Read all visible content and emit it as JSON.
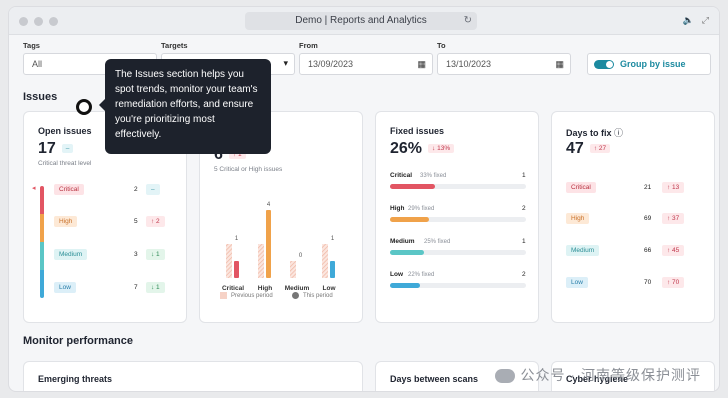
{
  "window": {
    "url_title": "Demo | Reports and Analytics",
    "reload_icon": "reload-icon"
  },
  "filters": {
    "tags_label": "Tags",
    "tags_value": "All",
    "targets_label": "Targets",
    "from_label": "From",
    "from_value": "13/09/2023",
    "to_label": "To",
    "to_value": "13/10/2023",
    "group_by_issue": "Group by issue"
  },
  "issues_heading": "Issues",
  "tooltip": {
    "text": "The Issues section helps you spot trends, monitor your team's remediation efforts, and ensure you're prioritizing most effectively."
  },
  "open_issues": {
    "title": "Open issues",
    "value": "17",
    "delta": "–",
    "sub": "Critical threat level",
    "rows": [
      {
        "label": "Critical",
        "count": "2",
        "delta": "–"
      },
      {
        "label": "High",
        "count": "5",
        "delta": "↑ 2"
      },
      {
        "label": "Medium",
        "count": "3",
        "delta": "↓ 1"
      },
      {
        "label": "Low",
        "count": "7",
        "delta": "↓ 1"
      }
    ]
  },
  "severity_chart": {
    "value": "6",
    "delta": "↑ 1",
    "sub": "5 Critical or High issues",
    "top_label": "4",
    "legend_previous": "Previous period",
    "legend_this": "This period"
  },
  "chart_data": {
    "type": "bar",
    "categories": [
      "Critical",
      "High",
      "Medium",
      "Low"
    ],
    "series": [
      {
        "name": "Previous period",
        "values": [
          2,
          2,
          1,
          2
        ]
      },
      {
        "name": "This period",
        "values": [
          1,
          4,
          0,
          1
        ]
      }
    ],
    "annotations": [
      "1",
      "4",
      "0",
      "1"
    ],
    "colors": {
      "previous": "#f2c4b8",
      "Critical": "#e25563",
      "High": "#f0a24a",
      "Medium": "#5bc6c6",
      "Low": "#3fa9d8"
    }
  },
  "fixed_issues": {
    "title": "Fixed issues",
    "value": "26%",
    "delta": "↓ 13%",
    "rows": [
      {
        "label": "Critical",
        "pct": "33% fixed",
        "count": "1",
        "fill": 0.33
      },
      {
        "label": "High",
        "pct": "29% fixed",
        "count": "2",
        "fill": 0.29
      },
      {
        "label": "Medium",
        "pct": "25% fixed",
        "count": "1",
        "fill": 0.25
      },
      {
        "label": "Low",
        "pct": "22% fixed",
        "count": "2",
        "fill": 0.22
      }
    ]
  },
  "days_to_fix": {
    "title": "Days to fix",
    "value": "47",
    "delta": "↑ 27",
    "rows": [
      {
        "label": "Critical",
        "count": "21",
        "delta": "↑ 13"
      },
      {
        "label": "High",
        "count": "69",
        "delta": "↑ 37"
      },
      {
        "label": "Medium",
        "count": "66",
        "delta": "↑ 45"
      },
      {
        "label": "Low",
        "count": "70",
        "delta": "↑ 70"
      }
    ]
  },
  "monitor": {
    "heading": "Monitor performance",
    "emerging_threats": "Emerging threats",
    "days_between_scans": "Days between scans",
    "cyber_hygiene": "Cyber hygiene"
  },
  "watermark": "公众号 · 河南等级保护测评"
}
